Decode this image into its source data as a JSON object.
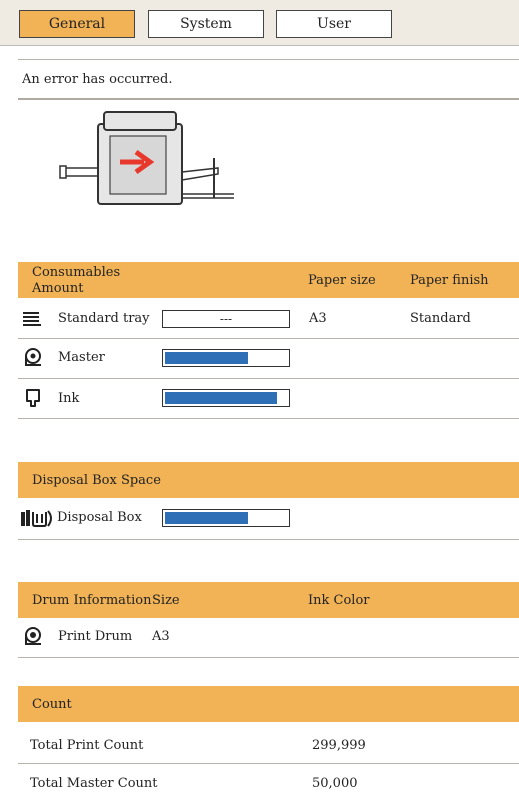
{
  "tabs": [
    {
      "label": "General",
      "active": true
    },
    {
      "label": "System",
      "active": false
    },
    {
      "label": "User",
      "active": false
    }
  ],
  "status_message": "An error has occurred.",
  "consumables": {
    "header_line1": "Consumables",
    "header_line2": "Amount",
    "paper_size_header": "Paper size",
    "paper_finish_header": "Paper finish",
    "rows": [
      {
        "label": "Standard tray",
        "level_text": "---",
        "paper_size": "A3",
        "paper_finish": "Standard"
      },
      {
        "label": "Master",
        "level": 0.68
      },
      {
        "label": "Ink",
        "level": 0.92
      }
    ]
  },
  "disposal": {
    "header": "Disposal Box Space",
    "rows": [
      {
        "label": "Disposal Box",
        "level": 0.68
      }
    ]
  },
  "drum": {
    "header": "Drum Information",
    "size_header": "Size",
    "ink_color_header": "Ink Color",
    "rows": [
      {
        "label": "Print Drum",
        "size": "A3"
      }
    ]
  },
  "count": {
    "header": "Count",
    "rows": [
      {
        "label": "Total Print Count",
        "value": "299,999"
      },
      {
        "label": "Total Master Count",
        "value": "50,000"
      }
    ]
  },
  "colors": {
    "accent": "#f1b356",
    "bar_fill": "#2f6fb6",
    "error_arrow": "#e8382b"
  },
  "icons": [
    "printer-error-icon",
    "paper-tray-icon",
    "master-roll-icon",
    "ink-cartridge-icon",
    "disposal-box-icon",
    "print-drum-icon"
  ]
}
